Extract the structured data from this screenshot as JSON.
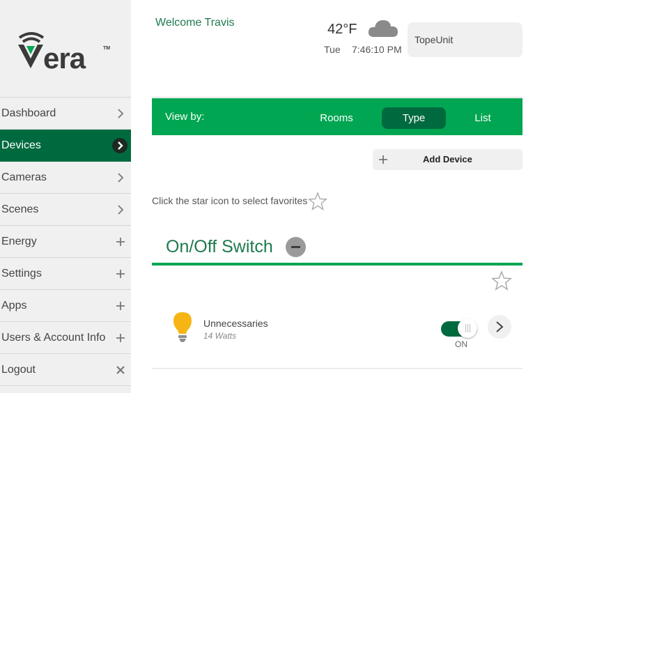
{
  "brand": {
    "name": "Vera",
    "trademark": "TM"
  },
  "header": {
    "welcome": "Welcome Travis",
    "temperature": "42°F",
    "day": "Tue",
    "time": "7:46:10 PM",
    "unit_name": "TopeUnit",
    "weather_icon": "cloud-icon"
  },
  "sidebar": {
    "items": [
      {
        "label": "Dashboard",
        "icon": "chevron-right-icon",
        "active": false
      },
      {
        "label": "Devices",
        "icon": "chevron-right-icon",
        "active": true
      },
      {
        "label": "Cameras",
        "icon": "chevron-right-icon",
        "active": false
      },
      {
        "label": "Scenes",
        "icon": "chevron-right-icon",
        "active": false
      },
      {
        "label": "Energy",
        "icon": "plus-icon",
        "active": false
      },
      {
        "label": "Settings",
        "icon": "plus-icon",
        "active": false
      },
      {
        "label": "Apps",
        "icon": "plus-icon",
        "active": false
      },
      {
        "label": "Users & Account Info",
        "icon": "plus-icon",
        "active": false
      },
      {
        "label": "Logout",
        "icon": "close-icon",
        "active": false
      }
    ]
  },
  "viewby": {
    "label": "View by:",
    "tabs": [
      {
        "label": "Rooms",
        "selected": false
      },
      {
        "label": "Type",
        "selected": true
      },
      {
        "label": "List",
        "selected": false
      }
    ]
  },
  "add_device": {
    "label": "Add Device",
    "icon": "plus-icon"
  },
  "favorites_hint": "Click the star icon to select favorites",
  "category": {
    "title": "On/Off Switch",
    "devices": [
      {
        "name": "Unnecessaries",
        "power": "14 Watts",
        "state_label": "ON",
        "on": true,
        "icon": "lightbulb-icon"
      }
    ]
  },
  "colors": {
    "accent_green": "#00a651",
    "dark_green": "#006a3f",
    "title_green": "#1e7a4e",
    "bulb_yellow": "#f7b515"
  }
}
